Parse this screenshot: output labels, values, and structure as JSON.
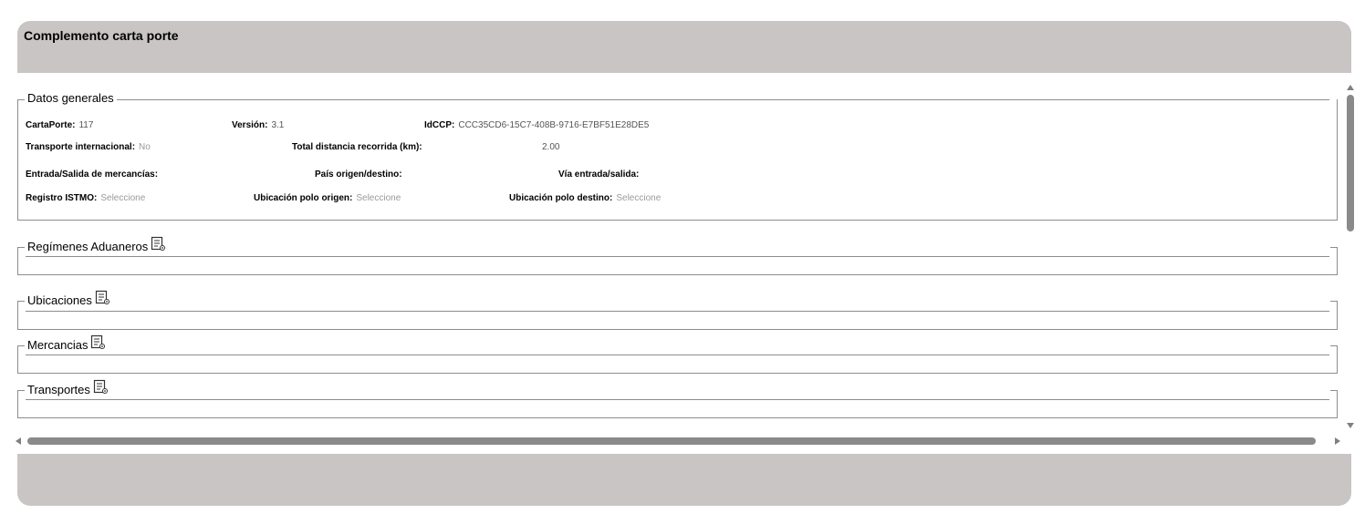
{
  "panel": {
    "title": "Complemento carta porte"
  },
  "datos_generales": {
    "legend": "Datos generales",
    "carta_porte": {
      "label": "CartaPorte:",
      "value": "117"
    },
    "version": {
      "label": "Versión:",
      "value": "3.1"
    },
    "idccp": {
      "label": "IdCCP:",
      "value": "CCC35CD6-15C7-408B-9716-E7BF51E28DE5"
    },
    "transporte_internacional": {
      "label": "Transporte internacional:",
      "value": "No"
    },
    "total_distancia": {
      "label": "Total distancia recorrida (km):",
      "value": "2.00"
    },
    "entrada_salida": {
      "label": "Entrada/Salida de mercancías:"
    },
    "pais_origen": {
      "label": "País origen/destino:"
    },
    "via_entrada": {
      "label": "Vía entrada/salida:"
    },
    "registro_istmo": {
      "label": "Registro ISTMO:",
      "placeholder": "Seleccione"
    },
    "ubicacion_origen": {
      "label": "Ubicación polo origen:",
      "placeholder": "Seleccione"
    },
    "ubicacion_destino": {
      "label": "Ubicación polo destino:",
      "placeholder": "Seleccione"
    }
  },
  "sections": {
    "regimenes": {
      "legend": "Regímenes Aduaneros",
      "icon": "list-view-icon"
    },
    "ubicaciones": {
      "legend": "Ubicaciones",
      "icon": "list-view-icon"
    },
    "mercancias": {
      "legend": "Mercancias",
      "icon": "list-view-icon"
    },
    "transportes": {
      "legend": "Transportes",
      "icon": "list-view-icon"
    }
  },
  "colors": {
    "header_bg": "#c9c5c4",
    "border": "#8d8d8d",
    "scroll_thumb": "#8a8a8a"
  }
}
